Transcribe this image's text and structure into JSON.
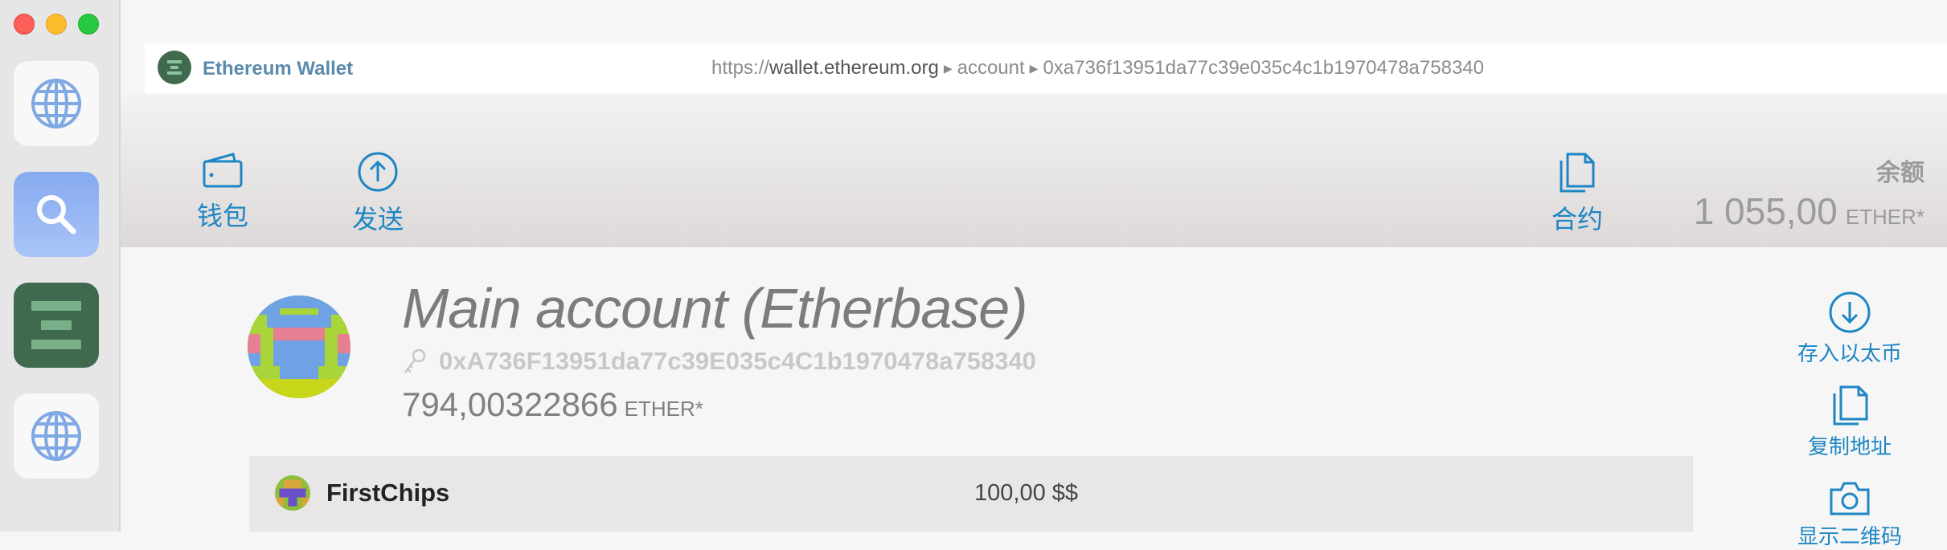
{
  "window": {
    "controls": [
      "close",
      "minimize",
      "zoom"
    ]
  },
  "dock": {
    "items": [
      {
        "icon": "globe-icon"
      },
      {
        "icon": "search-icon"
      },
      {
        "icon": "ethereum-wallet-icon"
      },
      {
        "icon": "globe-icon"
      }
    ]
  },
  "urlbar": {
    "app_title": "Ethereum Wallet",
    "scheme": "https://",
    "host": "wallet.ethereum.org",
    "crumb_1": "account",
    "crumb_2": "0xa736f13951da77c39e035c4c1b1970478a758340"
  },
  "header": {
    "nav": {
      "wallet": "钱包",
      "send": "发送",
      "contracts": "合约"
    },
    "balance_label": "余额",
    "balance_value": "1 055,00",
    "balance_unit": "ETHER*"
  },
  "account": {
    "name": "Main account (Etherbase)",
    "address": "0xA736F13951da77c39E035c4C1b1970478a758340",
    "balance": "794,00322866",
    "balance_unit": "ETHER*"
  },
  "tokens": [
    {
      "name": "FirstChips",
      "amount": "100,00 $$"
    }
  ],
  "actions": {
    "deposit": "存入以太币",
    "copy_address": "复制地址",
    "show_qr": "显示二维码"
  },
  "colors": {
    "accent": "#1e86c4",
    "brand_green": "#3f6a4e"
  }
}
